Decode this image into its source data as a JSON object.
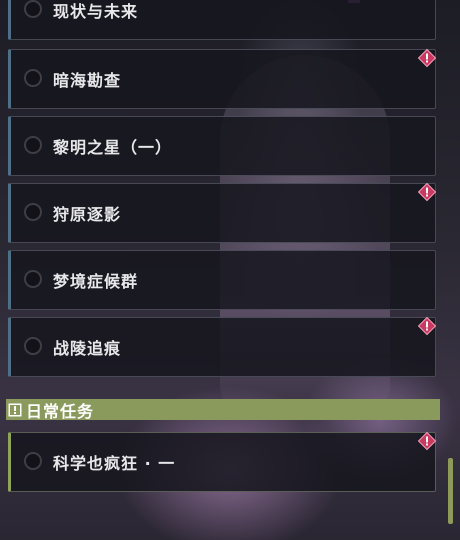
{
  "quests": [
    {
      "title": "现状与未来",
      "alert": false
    },
    {
      "title": "暗海勘查",
      "alert": true
    },
    {
      "title": "黎明之星（一）",
      "alert": false
    },
    {
      "title": "狩原逐影",
      "alert": true
    },
    {
      "title": "梦境症候群",
      "alert": false
    },
    {
      "title": "战陵追痕",
      "alert": true
    }
  ],
  "daily_section": {
    "title": "日常任务",
    "icon": "exclamation-box-icon"
  },
  "daily_quests": [
    {
      "title": "科学也疯狂 · 一",
      "alert": true
    }
  ],
  "colors": {
    "main_quest_accent": "#4f6f86",
    "daily_accent": "#8ea55a",
    "alert_badge": "#d0406a",
    "section_header": "#8a9a5c"
  }
}
